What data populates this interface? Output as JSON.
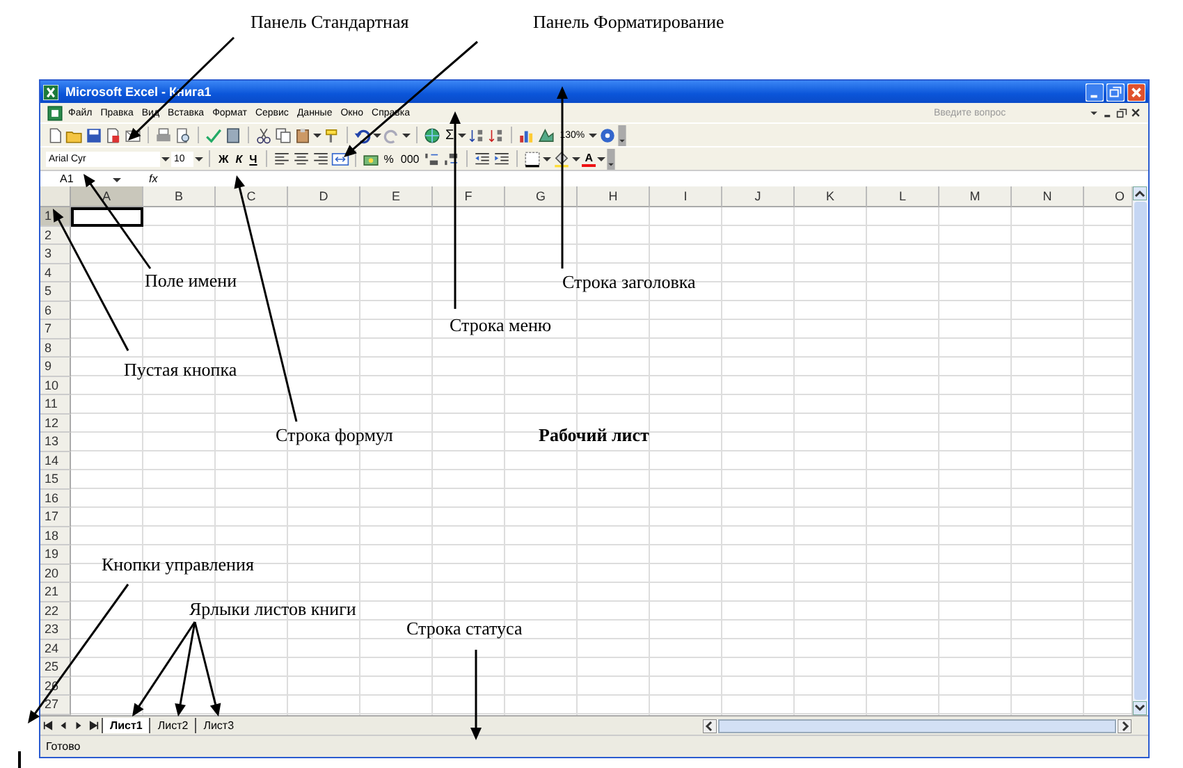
{
  "window": {
    "title": "Microsoft Excel - Книга1"
  },
  "menu": {
    "items": [
      "Файл",
      "Правка",
      "Вид",
      "Вставка",
      "Формат",
      "Сервис",
      "Данные",
      "Окно",
      "Справка"
    ],
    "help_search": {
      "placeholder": "Введите вопрос"
    }
  },
  "standard_toolbar": {
    "sum": "Σ",
    "zoom": "130%"
  },
  "formatting_toolbar": {
    "font": "Arial Cyr",
    "size": "10",
    "bold": "Ж",
    "italic": "К",
    "underline": "Ч",
    "percent": "%",
    "thousands": "000",
    "font_color": "A"
  },
  "formula_bar": {
    "name_box": "A1",
    "function_label": "fx"
  },
  "sheet": {
    "columns": [
      {
        "label": "A",
        "selected": true
      },
      {
        "label": "B",
        "selected": false
      },
      {
        "label": "C",
        "selected": false
      },
      {
        "label": "D",
        "selected": false
      },
      {
        "label": "E",
        "selected": false
      },
      {
        "label": "F",
        "selected": false
      },
      {
        "label": "G",
        "selected": false
      },
      {
        "label": "H",
        "selected": false
      },
      {
        "label": "I",
        "selected": false
      },
      {
        "label": "J",
        "selected": false
      },
      {
        "label": "K",
        "selected": false
      },
      {
        "label": "L",
        "selected": false
      },
      {
        "label": "M",
        "selected": false
      },
      {
        "label": "N",
        "selected": false
      },
      {
        "label": "O",
        "selected": false
      }
    ],
    "rows": [
      {
        "label": "1",
        "selected": true
      },
      {
        "label": "2",
        "selected": false
      },
      {
        "label": "3",
        "selected": false
      },
      {
        "label": "4",
        "selected": false
      },
      {
        "label": "5",
        "selected": false
      },
      {
        "label": "6",
        "selected": false
      },
      {
        "label": "7",
        "selected": false
      },
      {
        "label": "8",
        "selected": false
      },
      {
        "label": "9",
        "selected": false
      },
      {
        "label": "10",
        "selected": false
      },
      {
        "label": "11",
        "selected": false
      },
      {
        "label": "12",
        "selected": false
      },
      {
        "label": "13",
        "selected": false
      },
      {
        "label": "14",
        "selected": false
      },
      {
        "label": "15",
        "selected": false
      },
      {
        "label": "16",
        "selected": false
      },
      {
        "label": "17",
        "selected": false
      },
      {
        "label": "18",
        "selected": false
      },
      {
        "label": "19",
        "selected": false
      },
      {
        "label": "20",
        "selected": false
      },
      {
        "label": "21",
        "selected": false
      },
      {
        "label": "22",
        "selected": false
      },
      {
        "label": "23",
        "selected": false
      },
      {
        "label": "24",
        "selected": false
      },
      {
        "label": "25",
        "selected": false
      },
      {
        "label": "26",
        "selected": false
      },
      {
        "label": "27",
        "selected": false
      }
    ]
  },
  "sheet_tabs": [
    {
      "label": "Лист1",
      "selected": true
    },
    {
      "label": "Лист2",
      "selected": false
    },
    {
      "label": "Лист3",
      "selected": false
    }
  ],
  "status_bar": {
    "text": "Готово"
  },
  "annotations": [
    {
      "kind": "callout",
      "text": "Панель Стандартная"
    },
    {
      "kind": "callout",
      "text": "Панель Форматирование"
    },
    {
      "kind": "callout",
      "text": "Поле имени"
    },
    {
      "kind": "callout",
      "text": "Строка заголовка"
    },
    {
      "kind": "callout",
      "text": "Строка меню"
    },
    {
      "kind": "callout",
      "text": "Пустая кнопка"
    },
    {
      "kind": "callout",
      "text": "Строка формул"
    },
    {
      "kind": "heading",
      "text": "Рабочий лист"
    },
    {
      "kind": "callout",
      "text": "Кнопки управления"
    },
    {
      "kind": "callout",
      "text": "Ярлыки листов книги"
    },
    {
      "kind": "callout",
      "text": "Строка статуса"
    }
  ]
}
